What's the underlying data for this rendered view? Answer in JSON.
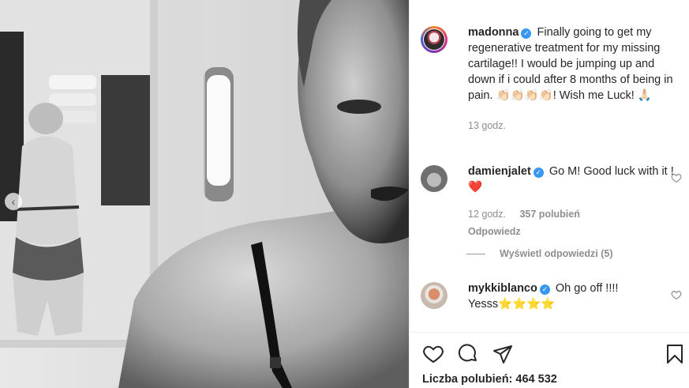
{
  "post": {
    "username": "madonna",
    "caption": "Finally going to get my regenerative treatment for my missing cartilage!! I would be jumping up and down if i could after 8 months of being in pain. 👏🏻👏🏻👏🏻👏🏻! Wish me Luck! 🙏🏻",
    "time": "13 godz.",
    "verified_icon": "verified-badge-icon"
  },
  "comments": [
    {
      "username": "damienjalet",
      "text": "Go M! Good luck with it ! ❤️",
      "time": "12 godz.",
      "likes": "357 polubień",
      "reply": "Odpowiedz"
    },
    {
      "username": "mykkiblanco",
      "text": "Oh go off !!!! Yesss⭐⭐⭐⭐"
    }
  ],
  "view_replies": "Wyświetl odpowiedzi (5)",
  "footer": {
    "likes_label": "Liczba polubień: 464 532"
  },
  "icons": [
    "heart-icon",
    "comment-icon",
    "share-icon",
    "bookmark-icon",
    "chevron-left-icon"
  ],
  "colors": {
    "verified": "#3897f0",
    "muted": "#8e8e8e",
    "text": "#262626"
  }
}
